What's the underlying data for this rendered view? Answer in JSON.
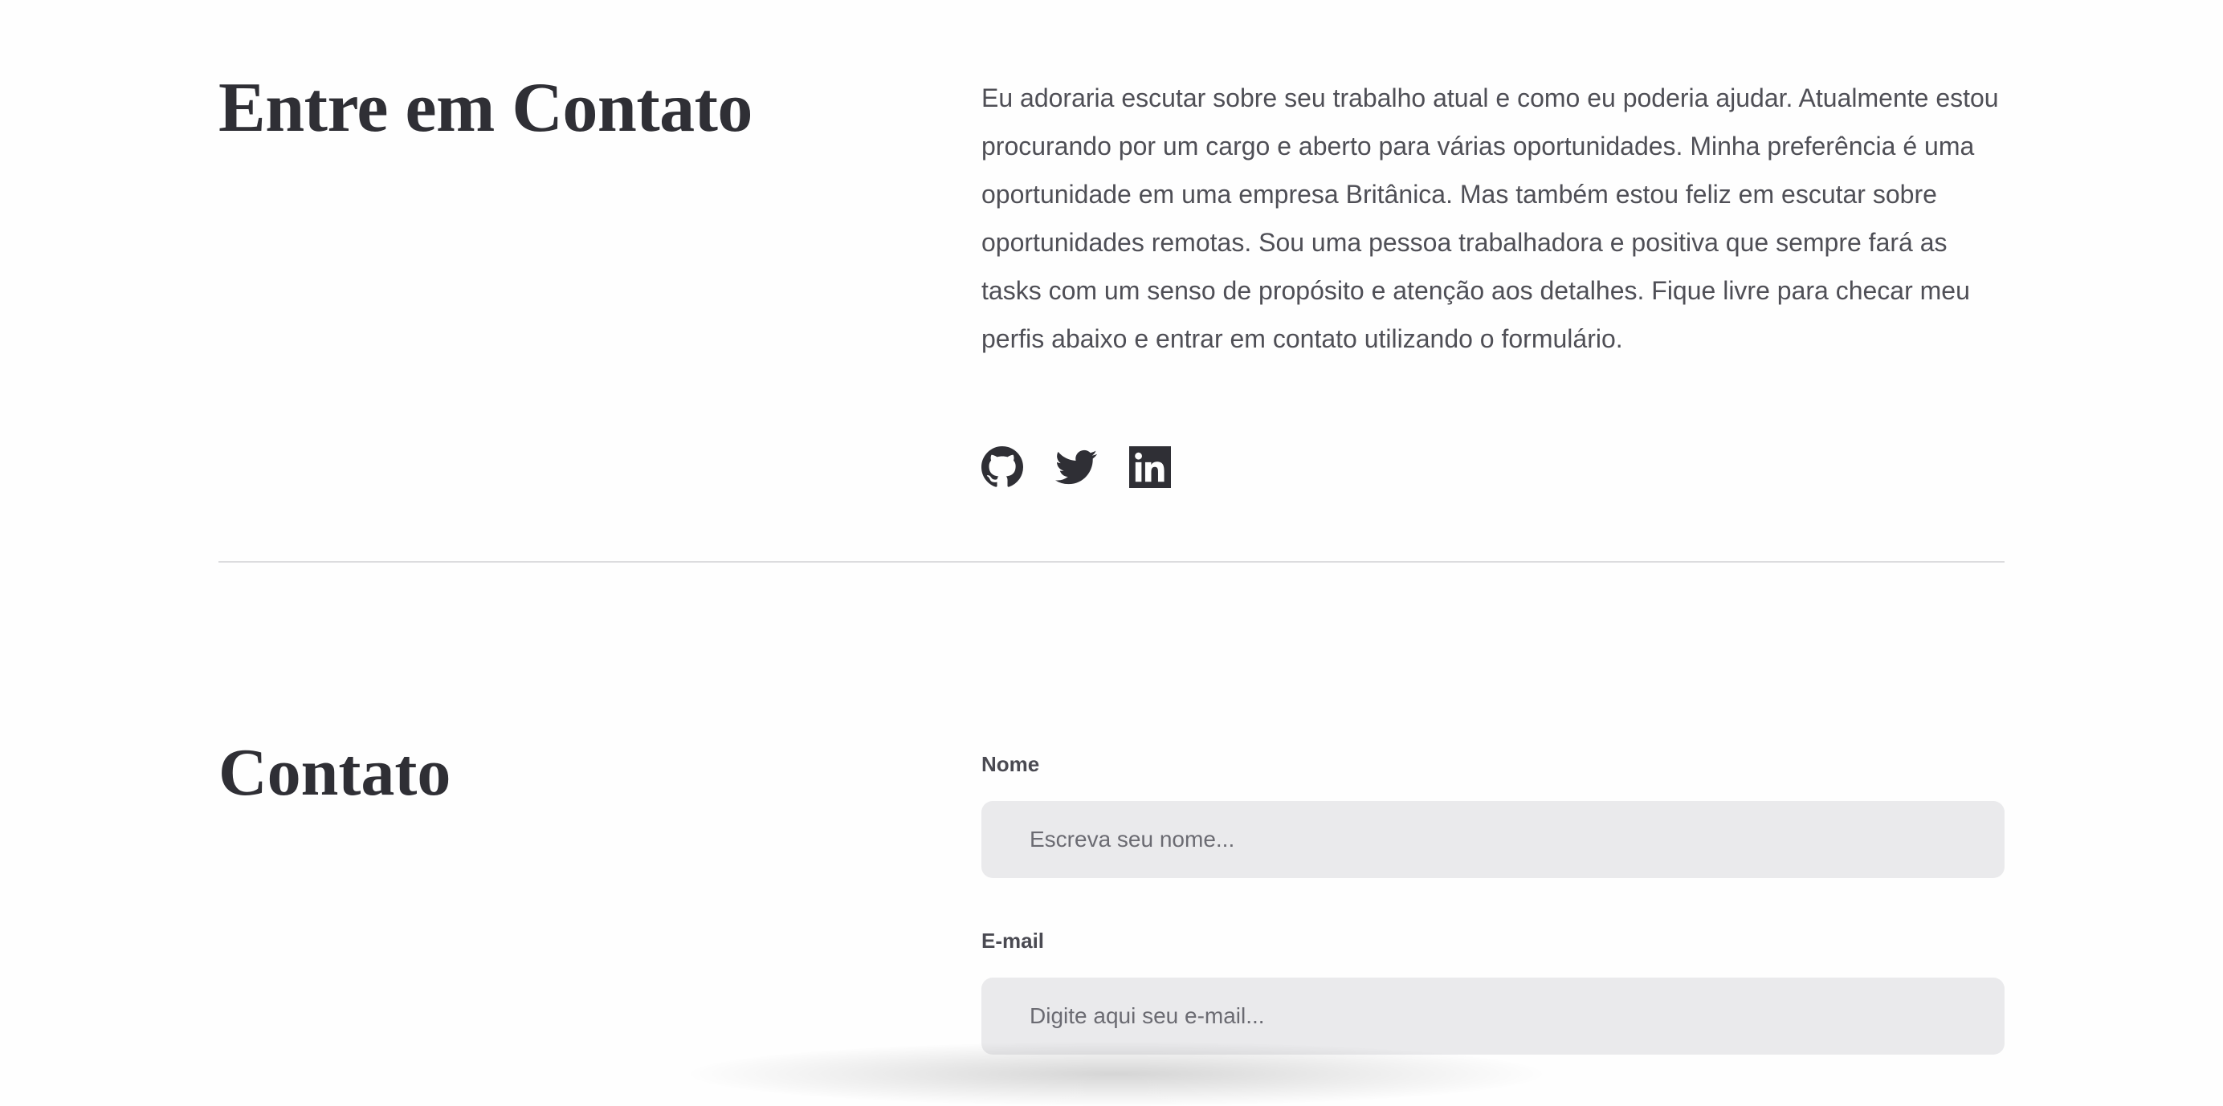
{
  "intro": {
    "title": "Entre em Contato",
    "paragraph": "Eu adoraria escutar sobre seu trabalho atual e como eu poderia ajudar. Atualmente estou procurando por um cargo e aberto para várias oportunidades. Minha preferência é uma oportunidade em uma empresa Britânica. Mas também estou feliz em escutar sobre oportunidades remotas. Sou uma pessoa trabalhadora e positiva que sempre fará as tasks com um senso de propósito e atenção aos detalhes. Fique livre para checar meu perfis abaixo e entrar em contato utilizando o formulário.",
    "socials": [
      {
        "icon": "github-icon"
      },
      {
        "icon": "twitter-icon"
      },
      {
        "icon": "linkedin-icon"
      }
    ]
  },
  "contact": {
    "title": "Contato",
    "name_label": "Nome",
    "name_placeholder": "Escreva seu nome...",
    "email_label": "E-mail",
    "email_placeholder": "Digite aqui seu e-mail..."
  },
  "colors": {
    "heading": "#2f2f35",
    "body_text": "#4f4f56",
    "input_bg": "#eaeaec",
    "divider": "#dcdcde"
  }
}
